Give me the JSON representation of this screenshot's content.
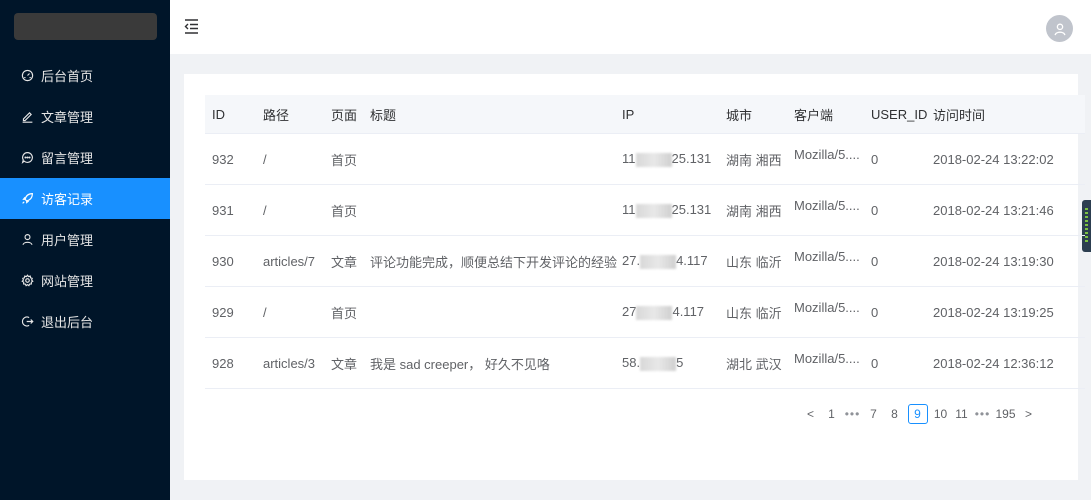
{
  "sidebar": {
    "items": [
      {
        "label": "后台首页",
        "icon": "dashboard-icon",
        "active": false
      },
      {
        "label": "文章管理",
        "icon": "edit-icon",
        "active": false
      },
      {
        "label": "留言管理",
        "icon": "message-icon",
        "active": false
      },
      {
        "label": "访客记录",
        "icon": "rocket-icon",
        "active": true
      },
      {
        "label": "用户管理",
        "icon": "user-icon",
        "active": false
      },
      {
        "label": "网站管理",
        "icon": "gear-icon",
        "active": false
      },
      {
        "label": "退出后台",
        "icon": "logout-icon",
        "active": false
      }
    ]
  },
  "header": {
    "fold_icon": "menu-fold-icon",
    "avatar_icon": "user-avatar-icon"
  },
  "table": {
    "columns": [
      "ID",
      "路径",
      "页面",
      "标题",
      "IP",
      "城市",
      "客户端",
      "USER_ID",
      "访问时间"
    ],
    "rows": [
      {
        "id": "932",
        "path": "/",
        "page": "首页",
        "title": "",
        "ip_start": "11",
        "ip_end": "25.131",
        "city": "湖南 湘西",
        "client": "Mozilla/5....",
        "uid": "0",
        "time": "2018-02-24 13:22:02"
      },
      {
        "id": "931",
        "path": "/",
        "page": "首页",
        "title": "",
        "ip_start": "11",
        "ip_end": "25.131",
        "city": "湖南 湘西",
        "client": "Mozilla/5....",
        "uid": "0",
        "time": "2018-02-24 13:21:46"
      },
      {
        "id": "930",
        "path": "articles/7",
        "page": "文章",
        "title": "评论功能完成，顺便总结下开发评论的经验",
        "ip_start": "27.",
        "ip_end": "4.117",
        "city": "山东 临沂",
        "client": "Mozilla/5....",
        "uid": "0",
        "time": "2018-02-24 13:19:30"
      },
      {
        "id": "929",
        "path": "/",
        "page": "首页",
        "title": "",
        "ip_start": "27",
        "ip_end": "4.117",
        "city": "山东 临沂",
        "client": "Mozilla/5....",
        "uid": "0",
        "time": "2018-02-24 13:19:25"
      },
      {
        "id": "928",
        "path": "articles/3",
        "page": "文章",
        "title": "我是 sad creeper， 好久不见咯",
        "ip_start": "58.",
        "ip_end": "5",
        "city": "湖北 武汉",
        "client": "Mozilla/5....",
        "uid": "0",
        "time": "2018-02-24 12:36:12"
      }
    ]
  },
  "pagination": {
    "prev": "<",
    "next": ">",
    "items": [
      "1",
      "•••",
      "7",
      "8",
      "9",
      "10",
      "11",
      "•••",
      "195"
    ],
    "current": "9"
  }
}
